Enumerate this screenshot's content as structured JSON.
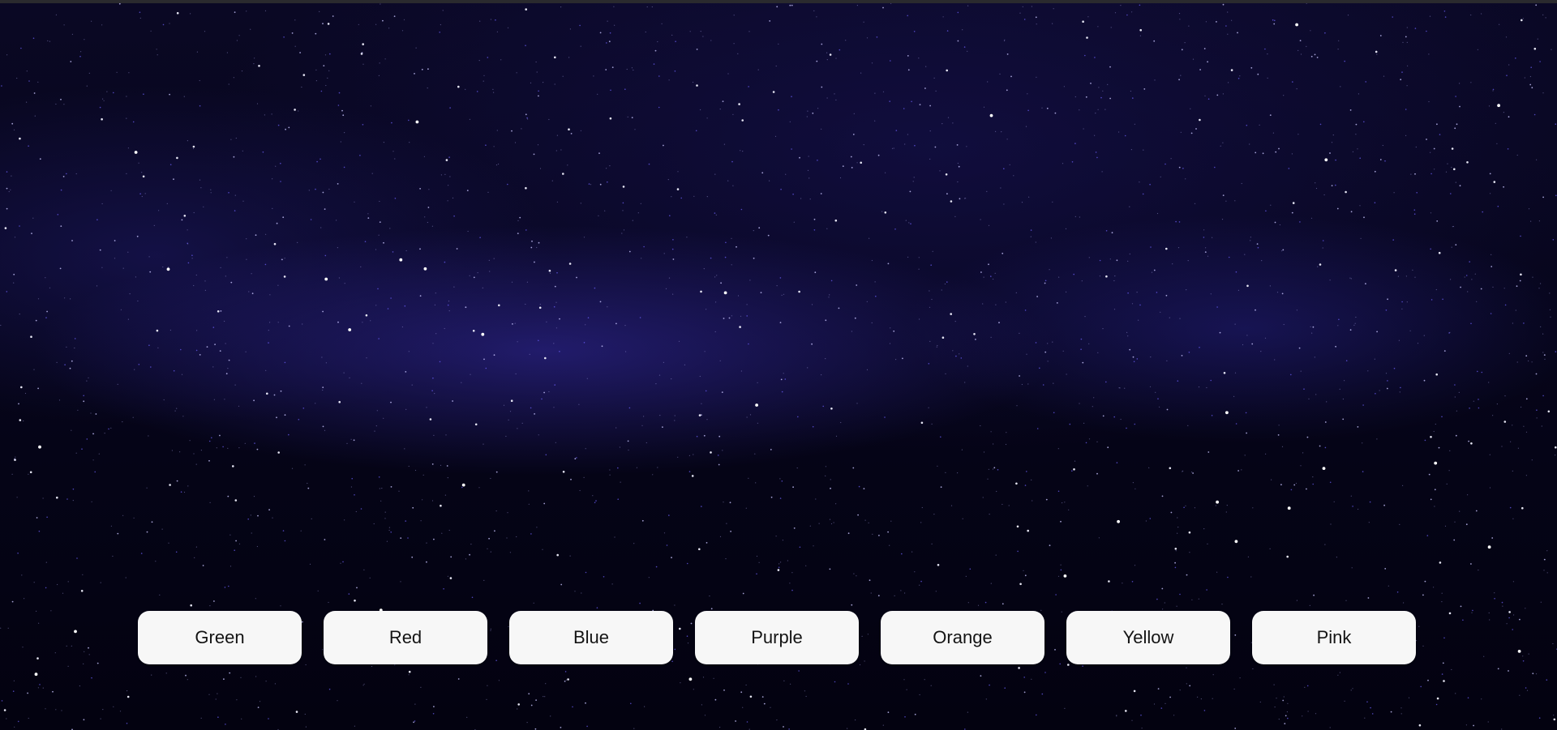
{
  "background": {
    "theme": "starry-night-sky",
    "colors": {
      "sky_dark": "#04030d",
      "milky_way": "#3a2fb0",
      "star": "#ffffff"
    }
  },
  "buttons": [
    {
      "label": "Green"
    },
    {
      "label": "Red"
    },
    {
      "label": "Blue"
    },
    {
      "label": "Purple"
    },
    {
      "label": "Orange"
    },
    {
      "label": "Yellow"
    },
    {
      "label": "Pink"
    }
  ]
}
